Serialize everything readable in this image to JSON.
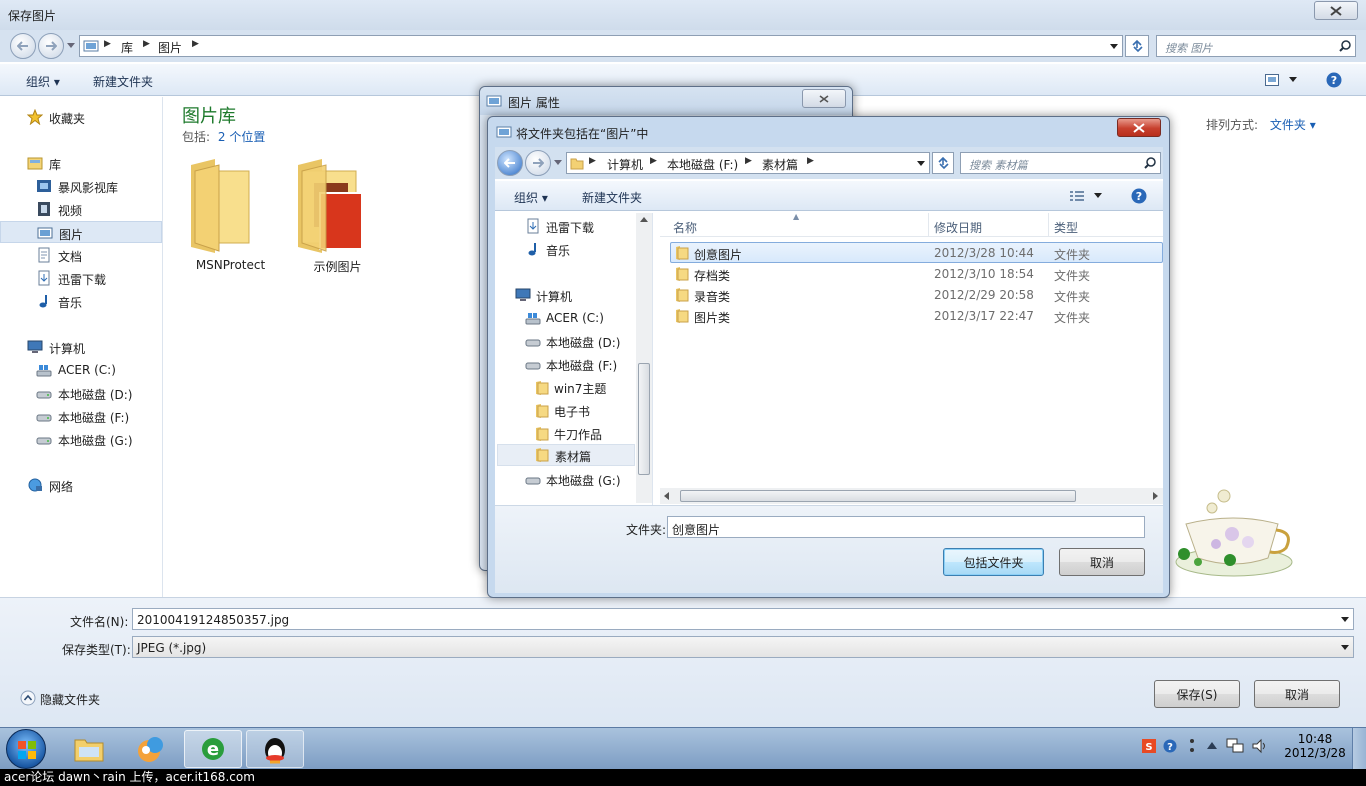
{
  "main": {
    "title": "保存图片",
    "breadcrumb": [
      "库",
      "图片"
    ],
    "search_placeholder": "搜索 图片",
    "toolbar": {
      "organize": "组织",
      "new_folder": "新建文件夹"
    },
    "nav": {
      "favorites": "收藏夹",
      "libraries": "库",
      "lib_items": [
        "暴风影视库",
        "视频",
        "图片",
        "文档",
        "迅雷下载",
        "音乐"
      ],
      "computer": "计算机",
      "drives": [
        "ACER (C:)",
        "本地磁盘 (D:)",
        "本地磁盘 (F:)",
        "本地磁盘 (G:)"
      ],
      "network": "网络"
    },
    "library_title": "图片库",
    "library_includes_label": "包括:",
    "library_includes_link": "2 个位置",
    "arrange_label": "排列方式:",
    "arrange_value": "文件夹",
    "items": [
      {
        "name": "MSNProtect"
      },
      {
        "name": "示例图片"
      }
    ],
    "filename_label": "文件名(N):",
    "filename_value": "20100419124850357.jpg",
    "filetype_label": "保存类型(T):",
    "filetype_value": "JPEG (*.jpg)",
    "hide_folders": "隐藏文件夹",
    "save_button": "保存(S)",
    "cancel_button": "取消"
  },
  "props_dialog": {
    "title": "图片 属性"
  },
  "include_dialog": {
    "title": "将文件夹包括在“图片”中",
    "breadcrumb": [
      "计算机",
      "本地磁盘 (F:)",
      "素材篇"
    ],
    "search_placeholder": "搜索 素材篇",
    "toolbar": {
      "organize": "组织",
      "new_folder": "新建文件夹"
    },
    "tree": [
      "迅雷下载",
      "音乐",
      "计算机",
      "ACER (C:)",
      "本地磁盘 (D:)",
      "本地磁盘 (F:)",
      "win7主题",
      "电子书",
      "牛刀作品",
      "素材篇",
      "本地磁盘 (G:)"
    ],
    "columns": [
      "名称",
      "修改日期",
      "类型"
    ],
    "rows": [
      {
        "name": "创意图片",
        "date": "2012/3/28 10:44",
        "type": "文件夹"
      },
      {
        "name": "存档类",
        "date": "2012/3/10 18:54",
        "type": "文件夹"
      },
      {
        "name": "录音类",
        "date": "2012/2/29 20:58",
        "type": "文件夹"
      },
      {
        "name": "图片类",
        "date": "2012/3/17 22:47",
        "type": "文件夹"
      }
    ],
    "folder_label": "文件夹:",
    "folder_value": "创意图片",
    "include_button": "包括文件夹",
    "cancel_button": "取消"
  },
  "taskbar": {
    "time": "10:48",
    "date": "2012/3/28"
  },
  "caption": "acer论坛 dawn丶rain 上传，acer.it168.com",
  "colors": {
    "accent": "#1a5fb4",
    "selection": "#dde8f5",
    "title_green": "#1e7a2c"
  }
}
